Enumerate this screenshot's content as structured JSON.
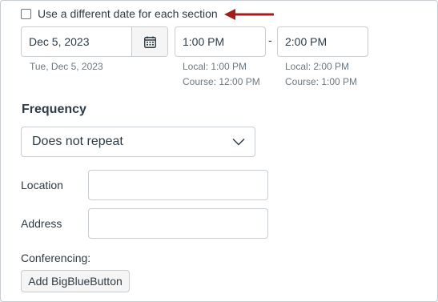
{
  "checkbox": {
    "label": "Use a different date for each section",
    "checked": false
  },
  "date": {
    "value": "Dec 5, 2023",
    "hint": "Tue, Dec 5, 2023"
  },
  "start_time": {
    "value": "1:00 PM",
    "local": "Local: 1:00 PM",
    "course": "Course: 12:00 PM"
  },
  "separator": "-",
  "end_time": {
    "value": "2:00 PM",
    "local": "Local: 2:00 PM",
    "course": "Course: 1:00 PM"
  },
  "frequency": {
    "heading": "Frequency",
    "selected": "Does not repeat"
  },
  "location": {
    "label": "Location",
    "value": ""
  },
  "address": {
    "label": "Address",
    "value": ""
  },
  "conferencing": {
    "label": "Conferencing:",
    "button": "Add BigBlueButton"
  },
  "colors": {
    "arrow": "#a51c1c",
    "border": "#c7cdd1",
    "text": "#2d3b45",
    "hint": "#6b7780"
  }
}
